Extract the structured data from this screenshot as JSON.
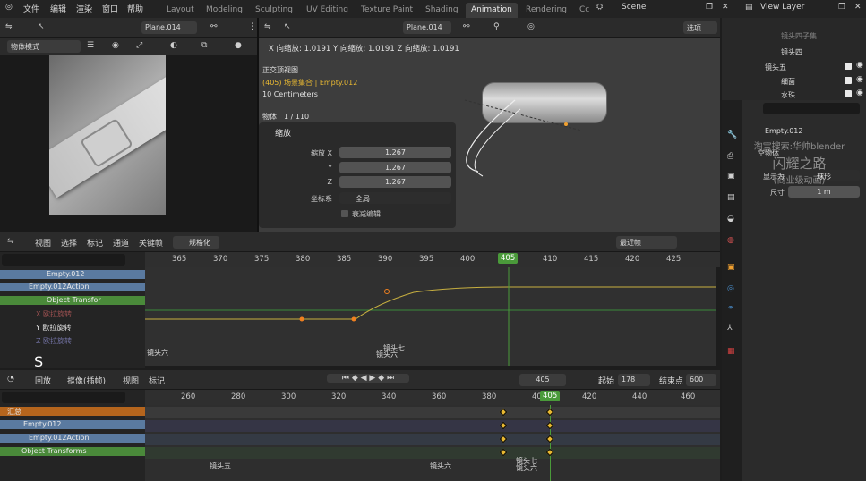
{
  "top_menu": {
    "file": "文件",
    "edit": "编辑",
    "render": "渲染",
    "window": "窗口",
    "help": "帮助"
  },
  "workspaces": [
    "Layout",
    "Modeling",
    "Sculpting",
    "UV Editing",
    "Texture Paint",
    "Shading",
    "Animation",
    "Rendering",
    "Cc"
  ],
  "scene": "Scene",
  "view_layer": "View Layer",
  "left_view": {
    "mode": "物体模式",
    "object": "Plane.014"
  },
  "viewport": {
    "object": "Plane.014",
    "options": "选项",
    "status": "X 向缩放: 1.0191  Y 向缩放: 1.0191  Z 向缩放: 1.0191",
    "view_name": "正交顶视图",
    "collection": "(405) 场景集合 | Empty.012",
    "scale_text": "10 Centimeters",
    "object_count": "物体　1 / 110"
  },
  "redo_panel": {
    "title": "缩放",
    "x_label": "缩放 X",
    "y_label": "Y",
    "z_label": "Z",
    "x": "1.267",
    "y": "1.267",
    "z": "1.267",
    "orient_label": "坐标系",
    "orient": "全局",
    "edit_label": "衰减编辑"
  },
  "graph_editor": {
    "menus": [
      "视图",
      "选择",
      "标记",
      "通道",
      "关键帧"
    ],
    "normalize": "规格化",
    "interp": "最近帧",
    "ticks": [
      "365",
      "370",
      "375",
      "380",
      "385",
      "390",
      "395",
      "400",
      "405",
      "410",
      "415",
      "420",
      "425"
    ],
    "current": "405",
    "channels": [
      "Empty.012",
      "Empty.012Action",
      "Object Transfor",
      "X 欧拉旋转",
      "Y 欧拉旋转",
      "Z 欧拉旋转"
    ],
    "marker1": "镜头七",
    "marker2": "镜头六",
    "marker3": "镜头六",
    "cursor_label": "S"
  },
  "timeline": {
    "playback": "回放",
    "keying": "抠像(插帧)",
    "view": "视图",
    "marker": "标记",
    "current": "405",
    "start_label": "起始",
    "start": "178",
    "end_label": "结束点",
    "end": "600"
  },
  "dopesheet": {
    "ticks": [
      "260",
      "280",
      "300",
      "320",
      "340",
      "360",
      "380",
      "400",
      "420",
      "440",
      "460"
    ],
    "current": "405",
    "channels": [
      "汇总",
      "Empty.012",
      "Empty.012Action",
      "Object Transforms"
    ],
    "markers": [
      "镜头五",
      "镜头六",
      "镜头七",
      "镜头六"
    ]
  },
  "outliner": {
    "items": [
      "镜头四",
      "镜头五",
      "细菌",
      "水珠"
    ],
    "top_cut": "镜头四子集"
  },
  "properties": {
    "object": "Empty.012",
    "section": "空物体",
    "display_label": "显示为",
    "display": "球形",
    "size_label": "尺寸",
    "size": "1 m"
  },
  "watermark": {
    "line1": "淘宝搜索:华帅blender",
    "line2": "闪耀之路",
    "line3": "(商业级动画)"
  }
}
